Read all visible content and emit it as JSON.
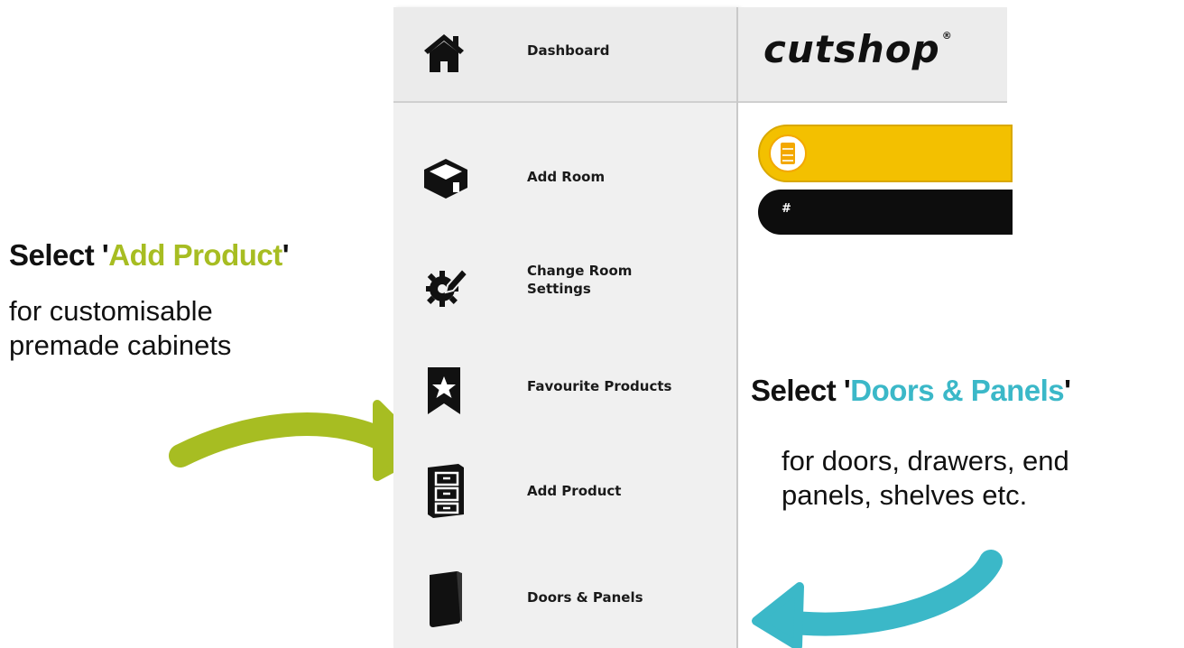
{
  "callouts": {
    "add_product": {
      "prefix": "Select '",
      "highlight": "Add Product",
      "suffix": "'",
      "line1": "for customisable",
      "line2": "premade cabinets",
      "accent_color": "#a7bd22"
    },
    "doors_panels": {
      "prefix": "Select '",
      "highlight": "Doors & Panels",
      "suffix": "'",
      "line1": "for doors, drawers, end",
      "line2": "panels, shelves etc.",
      "accent_color": "#3bb8c8"
    }
  },
  "sidebar": {
    "items": [
      {
        "label": "Dashboard",
        "icon": "house-icon"
      },
      {
        "label": "Add Room",
        "icon": "room-box-icon"
      },
      {
        "label": "Change Room Settings",
        "icon": "gear-pencil-icon"
      },
      {
        "label": "Favourite Products",
        "icon": "bookmark-star-icon"
      },
      {
        "label": "Add Product",
        "icon": "cabinet-drawers-icon"
      },
      {
        "label": "Doors & Panels",
        "icon": "door-panel-icon"
      }
    ]
  },
  "header": {
    "logo_text": "cutshop",
    "logo_mark": "®"
  },
  "main": {
    "row_header_symbol": "#",
    "accent_yellow": "#f3c000",
    "bar_black": "#0d0d0d"
  }
}
